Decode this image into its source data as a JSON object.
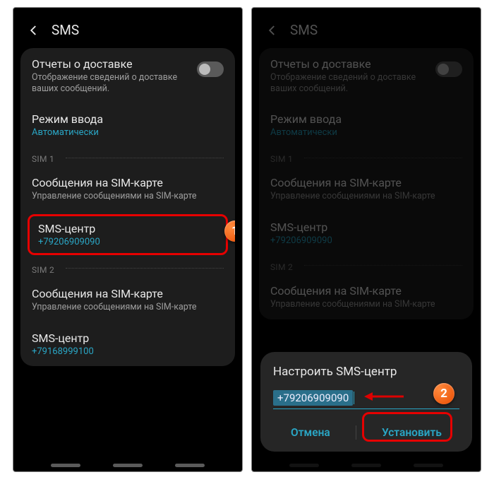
{
  "header": {
    "title": "SMS"
  },
  "settings": {
    "delivery": {
      "title": "Отчеты о доставке",
      "desc": "Отображение сведений о доставке ваших сообщений."
    },
    "inputMode": {
      "title": "Режим ввода",
      "value": "Автоматически"
    },
    "sim1Label": "SIM 1",
    "sim2Label": "SIM 2",
    "simMessages": {
      "title": "Сообщения на SIM-карте",
      "desc": "Управление сообщениями на SIM-карте"
    },
    "smsCenter1": {
      "title": "SMS-центр",
      "value": "+79206909090"
    },
    "smsCenter2": {
      "title": "SMS-центр",
      "value": "+79168999100"
    }
  },
  "dialog": {
    "title": "Настроить SMS-центр",
    "value": "+79206909090",
    "cancel": "Отмена",
    "ok": "Установить"
  },
  "badges": {
    "one": "1",
    "two": "2"
  }
}
